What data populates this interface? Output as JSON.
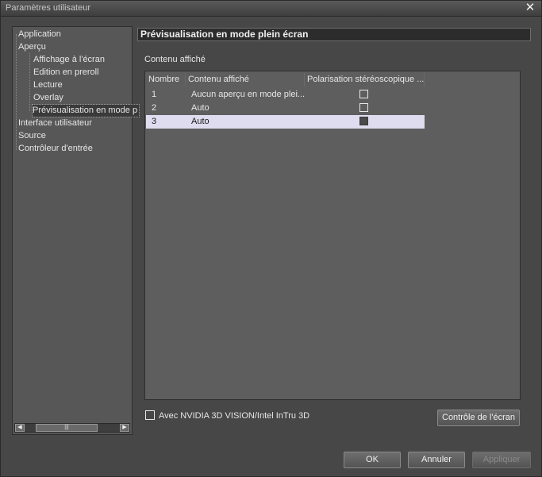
{
  "window": {
    "title": "Paramètres utilisateur"
  },
  "sidebar": {
    "items": [
      {
        "label": "Application"
      },
      {
        "label": "Aperçu"
      },
      {
        "label": "Affichage à l'écran"
      },
      {
        "label": "Edition en preroll"
      },
      {
        "label": "Lecture"
      },
      {
        "label": "Overlay"
      },
      {
        "label": "Prévisualisation en mode p"
      },
      {
        "label": "Interface utilisateur"
      },
      {
        "label": "Source"
      },
      {
        "label": "Contrôleur d'entrée"
      }
    ],
    "selected_label": "Prévisualisation en mode plein écran"
  },
  "panel": {
    "title": "Prévisualisation en mode plein écran",
    "section_label": "Contenu affiché",
    "columns": [
      "Nombre",
      "Contenu affiché",
      "Polarisation stéréoscopique ..."
    ],
    "rows": [
      {
        "number": "1",
        "content": "Aucun aperçu en mode plei...",
        "checked": false
      },
      {
        "number": "2",
        "content": "Auto",
        "checked": false
      },
      {
        "number": "3",
        "content": "Auto",
        "checked": false,
        "selected": true
      }
    ],
    "nvidia_label": "Avec NVIDIA 3D VISION/Intel InTru 3D",
    "nvidia_checked": false,
    "screen_control_button": "Contrôle de l'écran"
  },
  "footer": {
    "ok": "OK",
    "cancel": "Annuler",
    "apply": "Appliquer"
  },
  "colors": {
    "selected_row": "#e0dcf0",
    "panel_header_bg": "#2c2c2c"
  }
}
